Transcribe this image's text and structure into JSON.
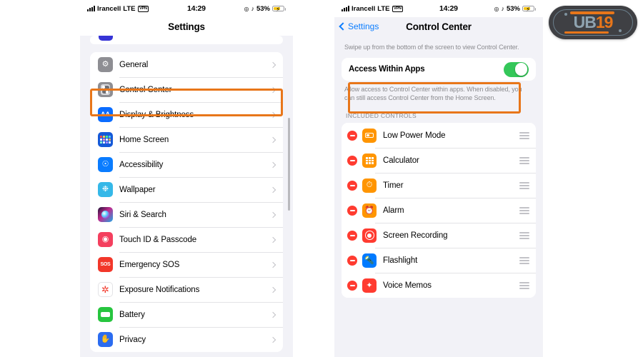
{
  "status_bar": {
    "carrier": "Irancell",
    "network": "LTE",
    "vpn_badge": "VPN",
    "time": "14:29",
    "battery_percent": "53%",
    "location_icon": "location-arrow-icon",
    "headphones_icon": "headphones-icon",
    "charging_icon": "lightning-bolt-icon"
  },
  "left_panel": {
    "nav_title": "Settings",
    "items": [
      {
        "label": "General",
        "icon": "gear-icon"
      },
      {
        "label": "Control Center",
        "icon": "control-center-icon"
      },
      {
        "label": "Display & Brightness",
        "icon": "display-brightness-icon"
      },
      {
        "label": "Home Screen",
        "icon": "home-screen-icon"
      },
      {
        "label": "Accessibility",
        "icon": "accessibility-icon"
      },
      {
        "label": "Wallpaper",
        "icon": "wallpaper-icon"
      },
      {
        "label": "Siri & Search",
        "icon": "siri-icon"
      },
      {
        "label": "Touch ID & Passcode",
        "icon": "touch-id-icon"
      },
      {
        "label": "Emergency SOS",
        "icon": "emergency-sos-icon"
      },
      {
        "label": "Exposure Notifications",
        "icon": "exposure-notifications-icon"
      },
      {
        "label": "Battery",
        "icon": "battery-icon"
      },
      {
        "label": "Privacy",
        "icon": "privacy-hand-icon"
      }
    ],
    "highlighted_item": "Control Center"
  },
  "right_panel": {
    "back_label": "Settings",
    "nav_title": "Control Center",
    "top_description": "Swipe up from the bottom of the screen to view Control Center.",
    "toggle": {
      "label": "Access Within Apps",
      "state": "on"
    },
    "toggle_description": "Allow access to Control Center within apps. When disabled, you can still access Control Center from the Home Screen.",
    "section_header": "INCLUDED CONTROLS",
    "controls": [
      {
        "label": "Low Power Mode",
        "icon": "low-power-mode-icon"
      },
      {
        "label": "Calculator",
        "icon": "calculator-icon"
      },
      {
        "label": "Timer",
        "icon": "timer-icon"
      },
      {
        "label": "Alarm",
        "icon": "alarm-clock-icon"
      },
      {
        "label": "Screen Recording",
        "icon": "screen-recording-icon"
      },
      {
        "label": "Flashlight",
        "icon": "flashlight-icon"
      },
      {
        "label": "Voice Memos",
        "icon": "voice-memos-icon"
      }
    ]
  },
  "logo": {
    "text_part1": "UB",
    "text_part2": "19"
  },
  "colors": {
    "highlight": "#e8761a",
    "toggle_on": "#34c759",
    "remove_button": "#ff3b30",
    "link": "#0a7cff",
    "panel_background": "#f2f2f7"
  }
}
